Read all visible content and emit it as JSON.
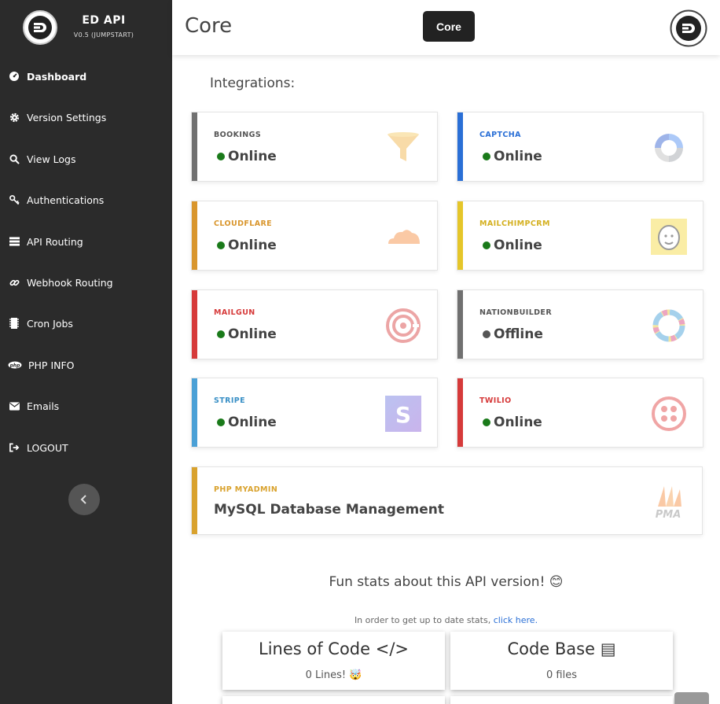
{
  "sidebar": {
    "brand_title": "ED API",
    "brand_version": "V0.5 (JUMPSTART)",
    "items": [
      {
        "label": "Dashboard",
        "icon": "dashboard-icon"
      },
      {
        "label": "Version Settings",
        "icon": "gear-icon"
      },
      {
        "label": "View Logs",
        "icon": "search-icon"
      },
      {
        "label": "Authentications",
        "icon": "key-icon"
      },
      {
        "label": "API Routing",
        "icon": "server-icon"
      },
      {
        "label": "Webhook Routing",
        "icon": "link-icon"
      },
      {
        "label": "Cron Jobs",
        "icon": "memory-icon"
      },
      {
        "label": "PHP INFO",
        "icon": "php-icon"
      },
      {
        "label": "Emails",
        "icon": "envelope-icon"
      },
      {
        "label": "LOGOUT",
        "icon": "sign-out-icon"
      }
    ]
  },
  "header": {
    "title": "Core",
    "core_button": "Core"
  },
  "main": {
    "section_title": "Integrations:",
    "integrations": [
      {
        "name": "BOOKINGS",
        "status": "Online",
        "bar_color": "#707070",
        "name_color": "#555555",
        "dot_color": "#1a7a1a",
        "icon": "funnel-icon"
      },
      {
        "name": "CAPTCHA",
        "status": "Online",
        "bar_color": "#2a6fd6",
        "name_color": "#2a6fd6",
        "dot_color": "#1a7a1a",
        "icon": "recaptcha-icon"
      },
      {
        "name": "CLOUDFLARE",
        "status": "Online",
        "bar_color": "#d9962d",
        "name_color": "#d9962d",
        "dot_color": "#1a7a1a",
        "icon": "cloud-icon"
      },
      {
        "name": "MAILCHIMPCRM",
        "status": "Online",
        "bar_color": "#e5c62a",
        "name_color": "#d4b01f",
        "dot_color": "#1a7a1a",
        "icon": "mailchimp-icon"
      },
      {
        "name": "MAILGUN",
        "status": "Online",
        "bar_color": "#d63a3a",
        "name_color": "#d63a3a",
        "dot_color": "#1a7a1a",
        "icon": "mailgun-icon"
      },
      {
        "name": "NATIONBUILDER",
        "status": "Offline",
        "bar_color": "#707070",
        "name_color": "#555555",
        "dot_color": "#555555",
        "icon": "nationbuilder-icon"
      },
      {
        "name": "STRIPE",
        "status": "Online",
        "bar_color": "#4aa0d6",
        "name_color": "#3a90c6",
        "dot_color": "#1a7a1a",
        "icon": "stripe-icon"
      },
      {
        "name": "TWILIO",
        "status": "Online",
        "bar_color": "#d63a3a",
        "name_color": "#d63a3a",
        "dot_color": "#1a7a1a",
        "icon": "twilio-icon"
      }
    ],
    "phpmyadmin": {
      "name": "PHP MYADMIN",
      "description": "MySQL Database Management",
      "icon": "pma-icon"
    },
    "stats": {
      "title": "Fun stats about this API version! 😊",
      "note_prefix": "In order to get up to date stats, ",
      "note_link": "click here.",
      "boxes": [
        {
          "title": "Lines of Code </>",
          "value": "0 Lines! 🤯"
        },
        {
          "title": "Code Base ▤",
          "value": "0 files"
        }
      ]
    }
  }
}
